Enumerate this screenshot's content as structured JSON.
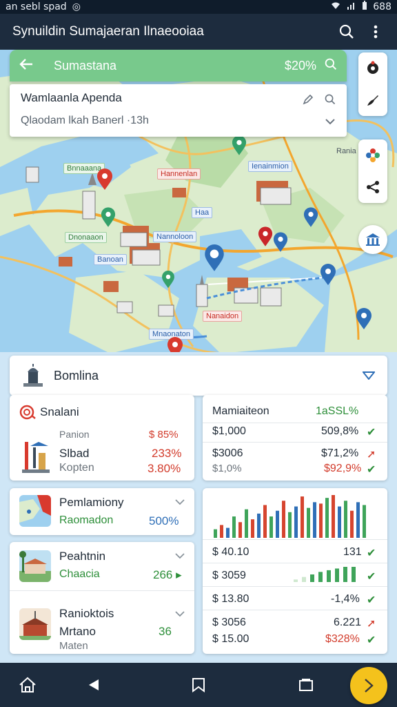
{
  "status": {
    "left_text": "an sebl spad",
    "right_text": "688"
  },
  "appbar": {
    "title": "Synuildin Sumajaeran Ilnaeooiaa"
  },
  "route": {
    "name": "Sumastana",
    "percent": "$20%"
  },
  "agenda": {
    "title": "Wamlaanla Apenda",
    "subtitle": "Qlaodam lkah Banerl  ·13h"
  },
  "map_labels": [
    {
      "text": "Rania",
      "style": "plain"
    },
    {
      "text": "Bnnaaana",
      "style": "g"
    },
    {
      "text": "Hannenlan",
      "style": "r"
    },
    {
      "text": "Ienainmion",
      "style": "b"
    },
    {
      "text": "Haa",
      "style": "b"
    },
    {
      "text": "Dnonaaon",
      "style": "g"
    },
    {
      "text": "Nannoloon",
      "style": "b"
    },
    {
      "text": "Banoan",
      "style": "b"
    },
    {
      "text": "Nanaidon",
      "style": "r"
    },
    {
      "text": "Mnaonaton",
      "style": "b"
    }
  ],
  "summary": {
    "name": "Bomlina"
  },
  "left_card": {
    "title": "Snalani",
    "row1": {
      "label": "Panion",
      "value": "$ 85%"
    },
    "row2": {
      "label": "Slbad",
      "value": "233%"
    },
    "row3": {
      "label": "Kopten",
      "value": "3.80%"
    }
  },
  "right_card": {
    "title": "Mamiaiteon",
    "title_value": "1aSSL%",
    "rows": [
      {
        "a": "$1,000",
        "b": "509,8%"
      },
      {
        "a": "$3006",
        "b": "$71,2%"
      },
      {
        "a": "$1,0%",
        "b": "$92,9%"
      }
    ]
  },
  "card_p1": {
    "title": "Pemlamiony",
    "sub": "Raomadon",
    "value": "500%"
  },
  "card_p2": {
    "title": "Peahtnin",
    "sub": "Chaacia",
    "value": "266 ▸"
  },
  "card_p3": {
    "title": "Ranioktois",
    "sub": "Mrtano",
    "sub_value": "36",
    "sub2": "Maten"
  },
  "right_list": {
    "rows": [
      {
        "a": "$ 40.10",
        "b": "131"
      },
      {
        "a": "$ 3059",
        "b": ""
      },
      {
        "a": "$ 13.80",
        "b": "-1,4%"
      },
      {
        "a": "$ 3056",
        "b": "6.221"
      },
      {
        "a": "$ 15.00",
        "b": "$328%"
      }
    ]
  },
  "mini_chart": {
    "type": "bar",
    "values": [
      12,
      18,
      14,
      30,
      22,
      40,
      26,
      34,
      46,
      30,
      38,
      52,
      36,
      44,
      58,
      42,
      50,
      48,
      56,
      60,
      44,
      52,
      38,
      50,
      46
    ],
    "colors": [
      "#3fa45a",
      "#d6452f",
      "#2f6fb7",
      "#3fa45a",
      "#d6452f",
      "#3fa45a",
      "#d6452f",
      "#2f6fb7",
      "#d6452f",
      "#3fa45a",
      "#2f6fb7",
      "#d6452f",
      "#3fa45a",
      "#2f6fb7",
      "#d6452f",
      "#3fa45a",
      "#2f6fb7",
      "#d6452f",
      "#3fa45a",
      "#d6452f",
      "#2f6fb7",
      "#3fa45a",
      "#d6452f",
      "#2f6fb7",
      "#3fa45a"
    ]
  },
  "spark_chart": {
    "type": "bar",
    "values": [
      3,
      6,
      9,
      12,
      14,
      16,
      18,
      18
    ],
    "colors": [
      "#cfe8cf",
      "#cfe8cf",
      "#3fa45a",
      "#3fa45a",
      "#3fa45a",
      "#3fa45a",
      "#3fa45a",
      "#3fa45a"
    ]
  },
  "icons": {
    "search": "search-icon",
    "more": "more-vert-icon",
    "back": "arrow-left-icon",
    "edit": "edit-icon",
    "expand": "chevron-down-icon",
    "home": "home-icon",
    "nav_back": "triangle-left-icon",
    "bookmark": "bookmark-icon",
    "recent": "square-icon",
    "next": "chevron-right-icon"
  },
  "colors": {
    "appbar": "#1d2c3e",
    "route_green": "#78c98c",
    "accent_yellow": "#f4c21c",
    "water": "#9ed0ef",
    "land": "#dceccd"
  }
}
